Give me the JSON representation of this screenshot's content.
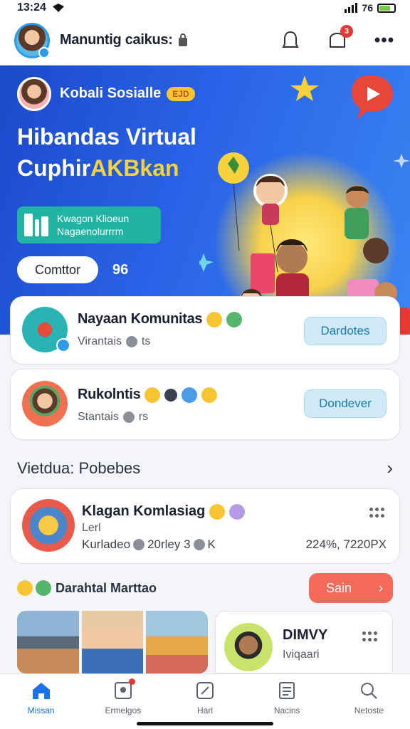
{
  "status_bar": {
    "time": "13:24",
    "battery": "76"
  },
  "app_bar": {
    "title": "Manuntig caikus:"
  },
  "icons": {
    "bell_badge": "3",
    "more": "•••"
  },
  "hero": {
    "brand": "Kobali Sosialle",
    "brand_tag": "EJD",
    "title_line1": "Hibandas Virtual",
    "title_line2_a": "Cuphir",
    "title_line2_b": "AKBkan",
    "panel_line1": "Kwagon Klioeun",
    "panel_line2": "Nagaenolurrrm",
    "button": "Comttor",
    "count": "96"
  },
  "communities": [
    {
      "name": "Nayaan Komunitas",
      "sub": "Virantais",
      "sub_suffix": "ts",
      "cta": "Dardotes"
    },
    {
      "name": "Rukolntis",
      "sub": "Stantais",
      "sub_suffix": "rs",
      "cta": "Dondever"
    }
  ],
  "section": {
    "title": "Vietdua: Pobebes"
  },
  "feature": {
    "title": "Klagan Komlasiag",
    "sub": "Lerl",
    "meta_a": "Kurladeo",
    "meta_b": "20rley 3",
    "meta_c": "K",
    "stats": "224%, 7220PX"
  },
  "promo": {
    "label": "Darahtal Marttao",
    "button": "Sain"
  },
  "mini_card": {
    "name": "DIMVY",
    "sub": "Iviqaari"
  },
  "nav": [
    {
      "label": "Missan",
      "icon": "home-icon"
    },
    {
      "label": "Ermelgos",
      "icon": "events-icon"
    },
    {
      "label": "Harl",
      "icon": "compose-icon"
    },
    {
      "label": "Nacins",
      "icon": "notes-icon"
    },
    {
      "label": "Netoste",
      "icon": "search-icon"
    }
  ],
  "colors": {
    "primary": "#1a73e8",
    "hero_start": "#1b49c9",
    "accent": "#f7d23a",
    "promo": "#f46a5a",
    "panel": "#23b3a3"
  }
}
